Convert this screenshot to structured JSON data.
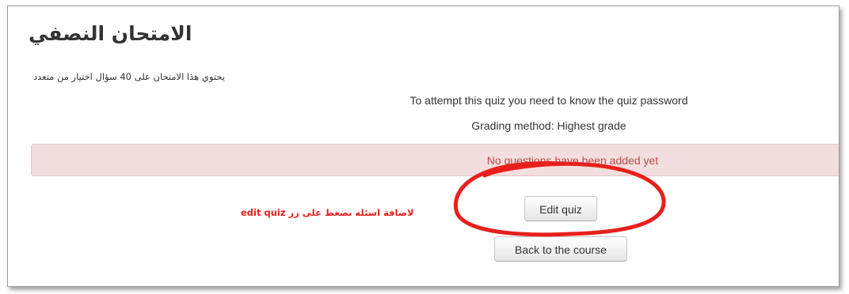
{
  "page": {
    "title": "الامتحان النصفي",
    "description": "يحتوي هذا الامتحان على 40 سؤال اختيار من متعدد"
  },
  "quiz_info": {
    "password_notice": "To attempt this quiz you need to know the quiz password",
    "grading_method": "Grading method: Highest grade"
  },
  "alert": {
    "message": "No questions have been added yet"
  },
  "buttons": {
    "edit_quiz": "Edit quiz",
    "back_to_course": "Back to the course"
  },
  "annotation": {
    "text": "لاضافة اسئله نضغط على زر edit quiz",
    "color": "#e8201c"
  },
  "colors": {
    "alert_background": "#f2dede",
    "alert_text": "#b94a48"
  }
}
